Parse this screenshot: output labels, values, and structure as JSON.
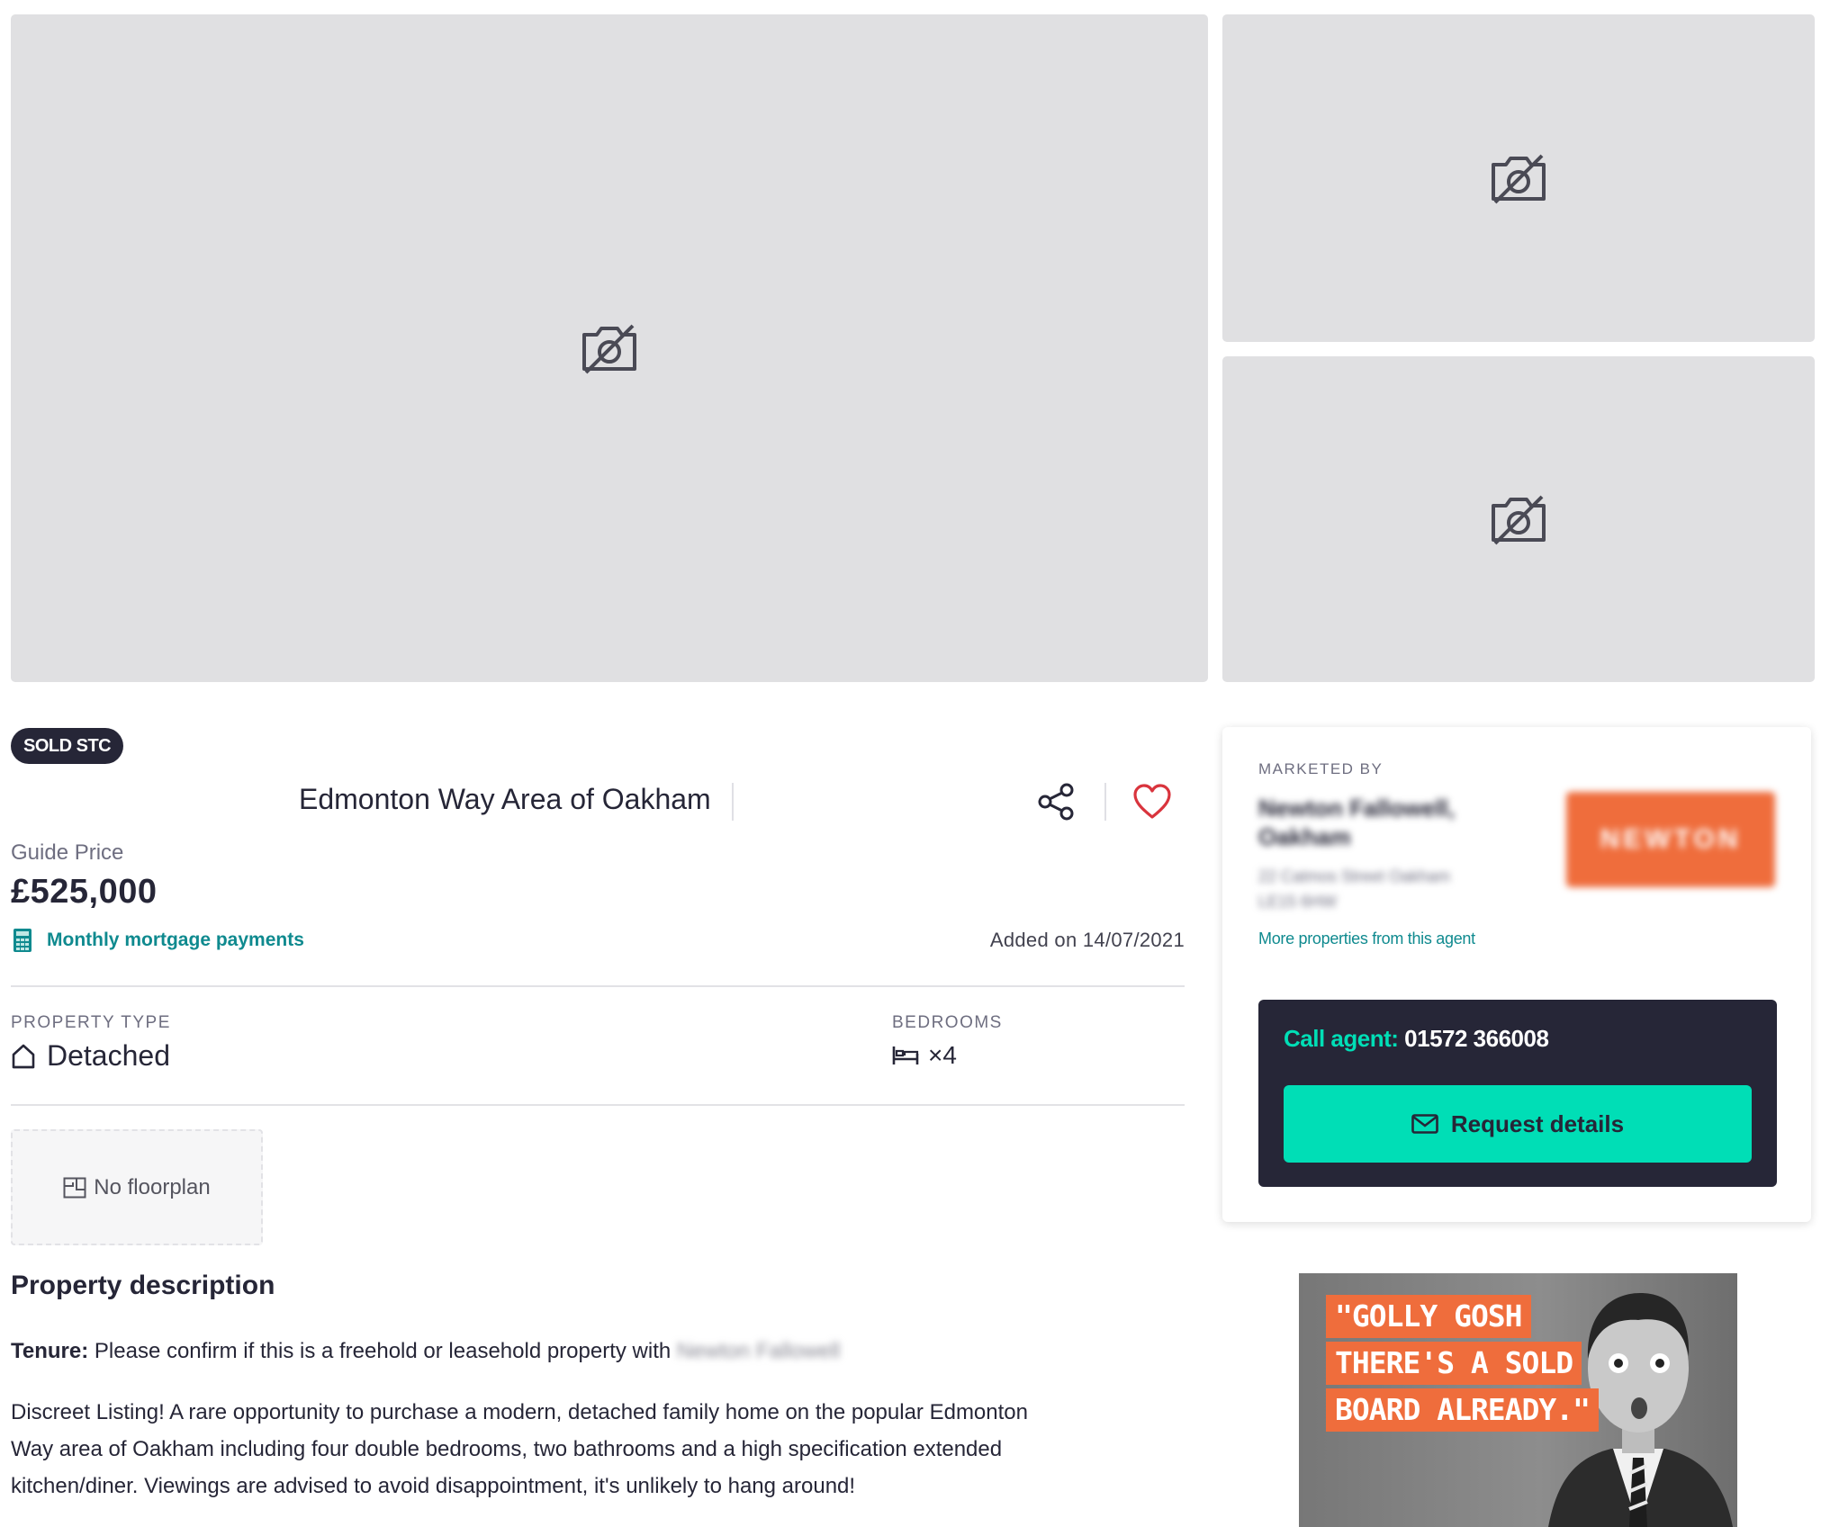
{
  "status_badge": "SOLD STC",
  "address": "Edmonton Way Area of Oakham",
  "price": {
    "label": "Guide Price",
    "value": "£525,000",
    "mortgage_link": "Monthly mortgage payments",
    "added": "Added on 14/07/2021"
  },
  "facts": {
    "type_label": "PROPERTY TYPE",
    "type_value": "Detached",
    "bed_label": "BEDROOMS",
    "bed_value": "×4"
  },
  "floorplan": "No floorplan",
  "description": {
    "heading": "Property description",
    "tenure_label": "Tenure:",
    "tenure_text": "Please confirm if this is a freehold or leasehold property with",
    "tenure_agent": "Newton Fallowell",
    "body_lines": [
      "Discreet Listing! A rare opportunity to purchase a modern, detached family home on the popular Edmonton",
      "Way area of Oakham including four double bedrooms, two bathrooms and a high specification extended",
      "kitchen/diner. Viewings are advised to avoid disappointment, it's unlikely to hang around!"
    ]
  },
  "agent": {
    "marketed_by": "MARKETED BY",
    "name_line1": "Newton Fallowell,",
    "name_line2": "Oakham",
    "addr_line1": "22 Catmos Street Oakham",
    "addr_line2": "LE15 6HW",
    "logo_text": "NEWTON",
    "more_link": "More properties from this agent",
    "call_label": "Call agent:",
    "phone": "01572 366008",
    "request_button": "Request details"
  },
  "ad": {
    "lines": [
      "\"GOLLY GOSH",
      "THERE'S A SOLD",
      "BOARD ALREADY.\""
    ]
  },
  "colors": {
    "accent": "#00deb6",
    "dark": "#262637",
    "link": "#0f8a8f",
    "favourite": "#d9343d",
    "ad_orange": "#ef6d3c"
  }
}
